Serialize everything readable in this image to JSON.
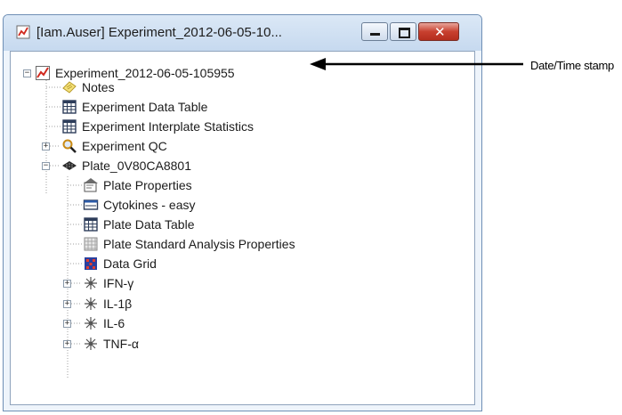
{
  "window": {
    "title": "[Iam.Auser] Experiment_2012-06-05-10...",
    "app_icon": "experiment-chart-icon"
  },
  "tree": {
    "root": {
      "label": "Experiment_2012-06-05-105955",
      "icon": "experiment-chart-icon",
      "expanded": true
    },
    "items": [
      {
        "label": "Notes",
        "icon": "notes-icon"
      },
      {
        "label": "Experiment Data Table",
        "icon": "table-icon"
      },
      {
        "label": "Experiment Interplate Statistics",
        "icon": "table-icon"
      },
      {
        "label": "Experiment QC",
        "icon": "magnifier-icon",
        "expanded": false
      },
      {
        "label": "Plate_0V80CA8801",
        "icon": "plate-icon",
        "expanded": true
      }
    ],
    "plate_children": [
      {
        "label": "Plate Properties",
        "icon": "properties-icon"
      },
      {
        "label": "Cytokines - easy",
        "icon": "layout-icon"
      },
      {
        "label": "Plate Data Table",
        "icon": "table-icon"
      },
      {
        "label": "Plate Standard Analysis Properties",
        "icon": "analysis-icon"
      },
      {
        "label": "Data Grid",
        "icon": "data-grid-icon"
      },
      {
        "label": "IFN-γ",
        "icon": "analyte-icon",
        "expanded": false
      },
      {
        "label": "IL-1β",
        "icon": "analyte-icon",
        "expanded": false
      },
      {
        "label": "IL-6",
        "icon": "analyte-icon",
        "expanded": false
      },
      {
        "label": "TNF-α",
        "icon": "analyte-icon",
        "expanded": false
      }
    ]
  },
  "annotation": {
    "label": "Date/Time stamp"
  },
  "colors": {
    "title_bg": "#c6d9ef",
    "close_red": "#c8402f",
    "arrow": "#000000"
  }
}
